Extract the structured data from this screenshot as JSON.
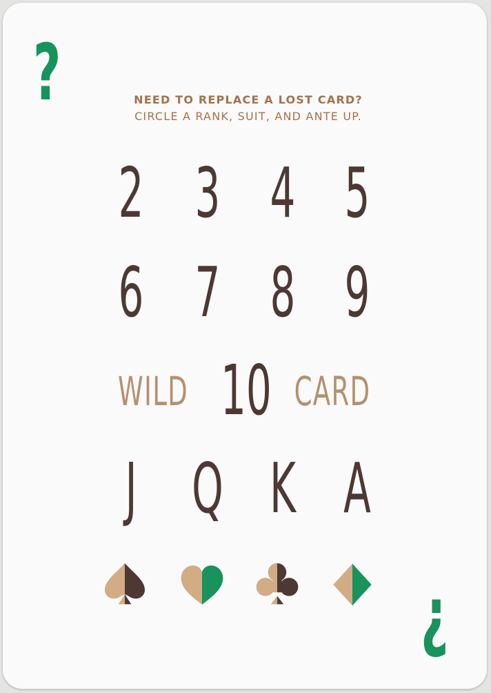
{
  "card": {
    "corner_top": "?",
    "corner_bottom": "¿",
    "header_line1": "NEED TO REPLACE A LOST CARD?",
    "header_line2": "CIRCLE A RANK, SUIT, AND ANTE UP.",
    "ranks_row1": [
      "2",
      "3",
      "4",
      "5"
    ],
    "ranks_row2": [
      "6",
      "7",
      "8",
      "9"
    ],
    "wild_label": "WILD",
    "ten_rank": "10",
    "card_label": "CARD",
    "ranks_row4": [
      "J",
      "Q",
      "K",
      "A"
    ],
    "suits": [
      "spade-icon",
      "heart-icon",
      "club-icon",
      "diamond-icon"
    ]
  },
  "colors": {
    "green": "#17935b",
    "header_brown": "#a5714b",
    "rank_brown": "#4d3833",
    "tan": "#b5916f",
    "suit_light": "#d1ac85",
    "suit_dark": "#4d3833"
  }
}
